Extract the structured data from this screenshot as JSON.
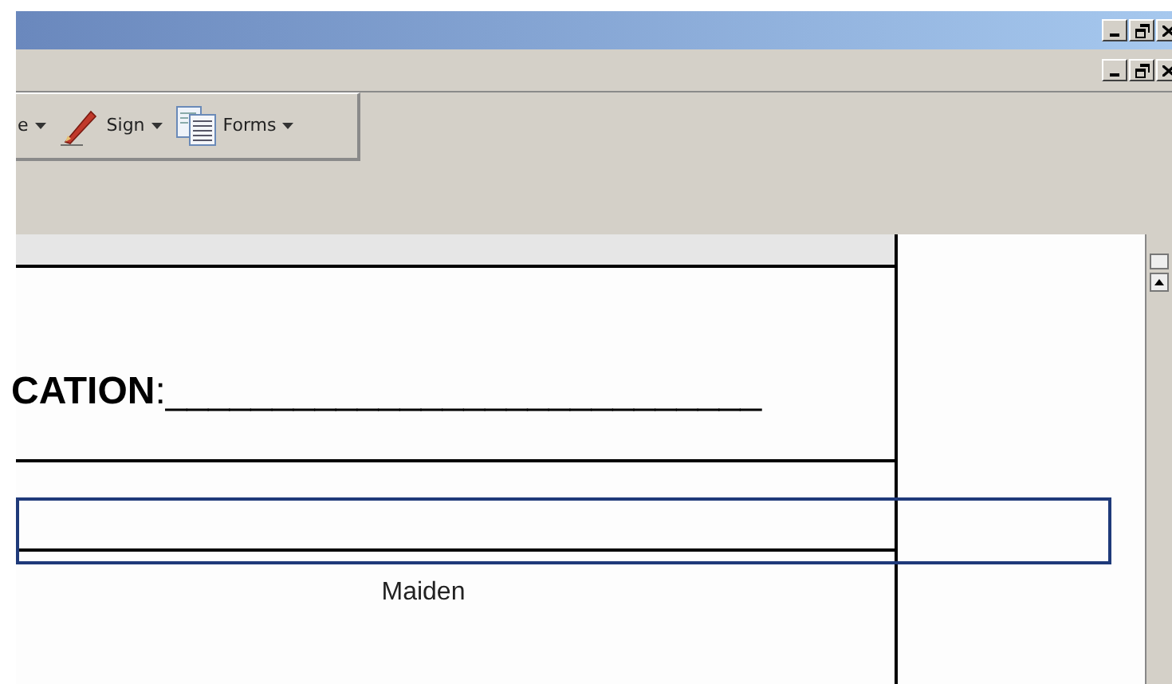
{
  "toolbar": {
    "items": [
      {
        "kind": "menu",
        "label": "e"
      },
      {
        "kind": "sign",
        "label": "Sign"
      },
      {
        "kind": "forms",
        "label": "Forms"
      }
    ]
  },
  "document": {
    "heading": "**CATION**:____________________________",
    "field": {
      "selected": true
    },
    "caption": "Maiden"
  }
}
